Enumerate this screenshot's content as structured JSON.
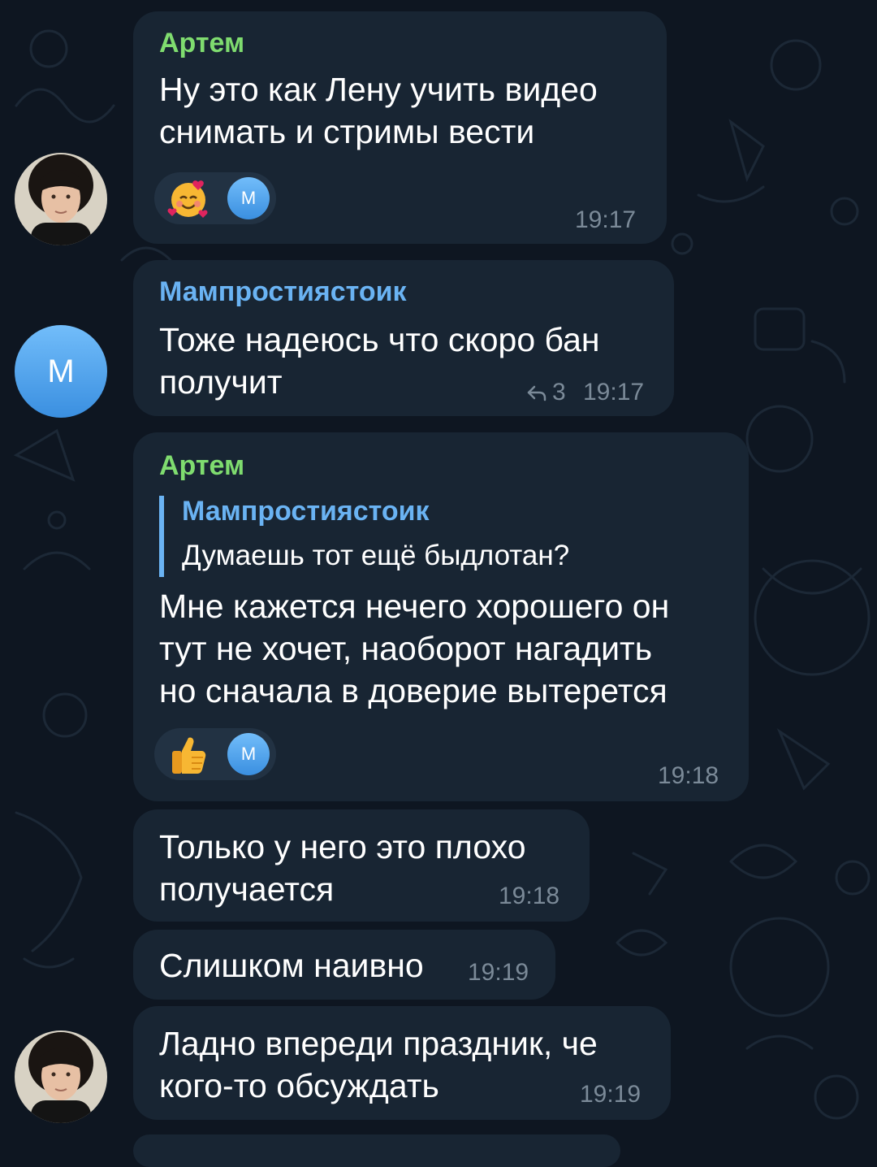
{
  "colors": {
    "background": "#0e1621",
    "bubble": "#182533",
    "sender_green": "#7fdc6f",
    "sender_blue": "#6ab3f3",
    "time_gray": "#7b8a98",
    "avatar_blue": "#4a9fe8"
  },
  "messages": [
    {
      "sender": "Артем",
      "line1": "Ну это как Лену учить видео",
      "line2": "снимать и стримы вести",
      "reaction_emoji": "smiling-face-with-hearts-icon",
      "reaction_avatar": "М",
      "time": "19:17"
    },
    {
      "sender": "Мампростиястоик",
      "avatar_letter": "М",
      "line1": "Тоже надеюсь что скоро бан",
      "line2": "получит",
      "reply_count": "3",
      "time": "19:17"
    },
    {
      "sender": "Артем",
      "quote_author": "Мампростиястоик",
      "quote_text": "Думаешь тот ещё быдлотан?",
      "line1": "Мне кажется нечего хорошего он",
      "line2": "тут не хочет, наоборот нагадить",
      "line3": "но сначала в доверие вытерется",
      "reaction_emoji": "thumbs-up-icon",
      "reaction_avatar": "М",
      "time": "19:18"
    },
    {
      "line1": "Только у него это плохо",
      "line2": "получается",
      "time": "19:18"
    },
    {
      "line1": "Слишком наивно",
      "time": "19:19"
    },
    {
      "line1": "Ладно впереди праздник, че",
      "line2": "кого-то обсуждать",
      "time": "19:19"
    }
  ]
}
